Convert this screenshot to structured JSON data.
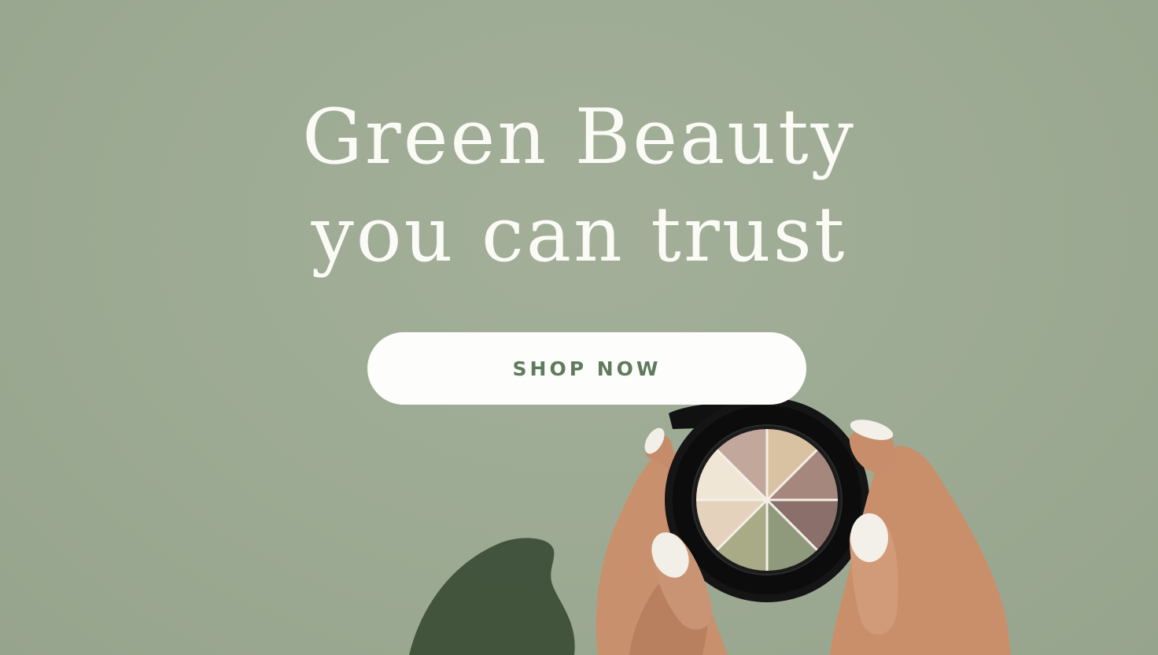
{
  "hero": {
    "headline_line1": "Green Beauty",
    "headline_line2": "you can trust",
    "cta_label": "SHOP NOW"
  },
  "colors": {
    "background": "#9daa93",
    "headline_text": "#fbfbf6",
    "button_bg": "#fdfdfb",
    "button_text": "#5f7a5c",
    "compact_case": "#141414"
  },
  "product": {
    "icon": "eyeshadow-palette-icon",
    "shades": [
      "#c2a89c",
      "#d9c2a2",
      "#a5877d",
      "#8a6f6b",
      "#8f9a7d",
      "#a8ab85",
      "#e4d2bd",
      "#efe6d6"
    ]
  }
}
